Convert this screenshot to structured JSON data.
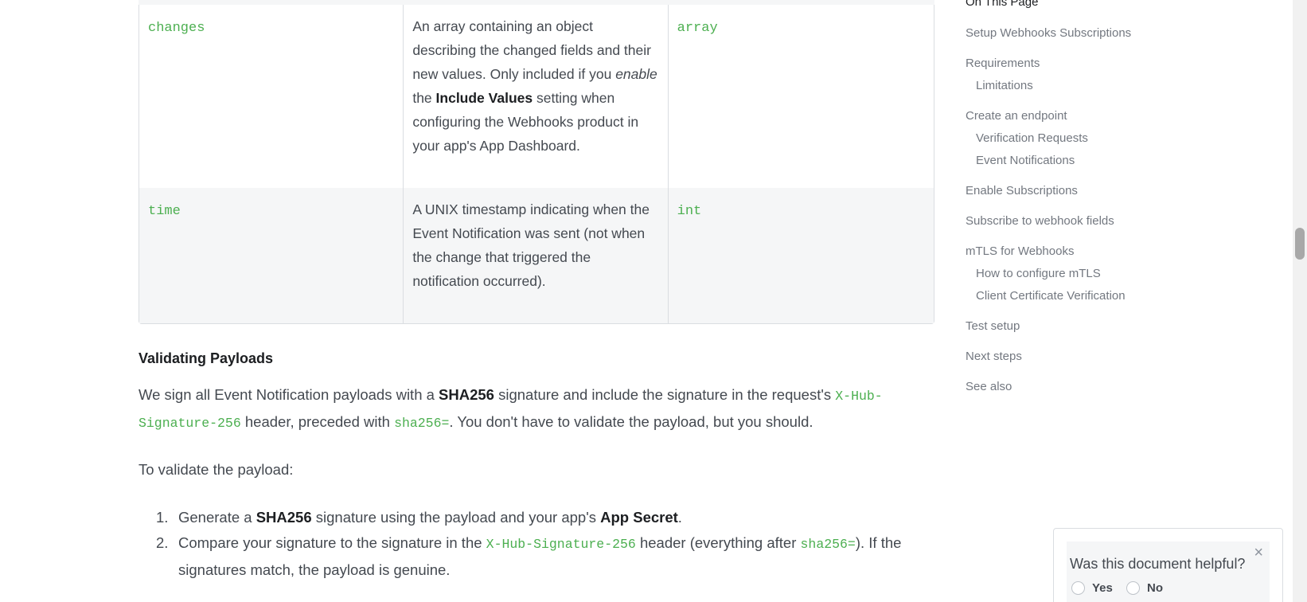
{
  "table": {
    "rows": [
      {
        "field": "changes",
        "desc_parts": [
          "An array containing an object describing the changed fields and their new values. Only included if you ",
          "enable",
          " the ",
          "Include Values",
          " setting when configuring the Webhooks product in your app's App Dashboard."
        ],
        "type": "array"
      },
      {
        "field": "time",
        "description": "A UNIX timestamp indicating when the Event Notification was sent (not when the change that triggered the notification occurred).",
        "type": "int"
      }
    ]
  },
  "validating": {
    "title": "Validating Payloads",
    "p1": {
      "a": "We sign all Event Notification payloads with a ",
      "b": "SHA256",
      "c": " signature and include the signature in the request's ",
      "code1": "X-Hub-Signature-256",
      "d": " header, preceded with ",
      "code2": "sha256=",
      "e": ". You don't have to validate the payload, but you should."
    },
    "p2": "To validate the payload:",
    "steps": [
      {
        "num": "1.",
        "a": "Generate a ",
        "b": "SHA256",
        "c": " signature using the payload and your app's ",
        "d": "App Secret",
        "e": "."
      },
      {
        "num": "2.",
        "a": "Compare your signature to the signature in the ",
        "code1": "X-Hub-Signature-256",
        "b": " header (everything after ",
        "code2": "sha256=",
        "c": "). If the signatures match, the payload is genuine."
      }
    ]
  },
  "toc": {
    "title": "On This Page",
    "items": [
      "Setup Webhooks Subscriptions",
      "Requirements",
      "Limitations",
      "Create an endpoint",
      "Verification Requests",
      "Event Notifications",
      "Enable Subscriptions",
      "Subscribe to webhook fields",
      "mTLS for Webhooks",
      "How to configure mTLS",
      "Client Certificate Verification",
      "Test setup",
      "Next steps",
      "See also"
    ]
  },
  "feedback": {
    "question": "Was this document helpful?",
    "yes": "Yes",
    "no": "No",
    "close_icon": "×"
  }
}
